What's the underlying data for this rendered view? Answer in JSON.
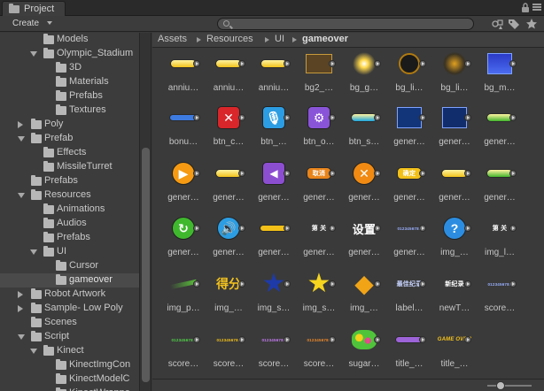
{
  "window": {
    "tab_title": "Project"
  },
  "toolbar": {
    "create_label": "Create",
    "search_placeholder": ""
  },
  "tree": [
    {
      "label": "Models",
      "depth": 1,
      "arrow": "none"
    },
    {
      "label": "Olympic_Stadium",
      "depth": 1,
      "arrow": "open"
    },
    {
      "label": "3D",
      "depth": 2,
      "arrow": "none"
    },
    {
      "label": "Materials",
      "depth": 2,
      "arrow": "none"
    },
    {
      "label": "Prefabs",
      "depth": 2,
      "arrow": "none"
    },
    {
      "label": "Textures",
      "depth": 2,
      "arrow": "none"
    },
    {
      "label": "Poly",
      "depth": 0,
      "arrow": "closed"
    },
    {
      "label": "Prefab",
      "depth": 0,
      "arrow": "open"
    },
    {
      "label": "Effects",
      "depth": 1,
      "arrow": "none"
    },
    {
      "label": "MissileTurret",
      "depth": 1,
      "arrow": "none"
    },
    {
      "label": "Prefabs",
      "depth": 0,
      "arrow": "none"
    },
    {
      "label": "Resources",
      "depth": 0,
      "arrow": "open"
    },
    {
      "label": "Animations",
      "depth": 1,
      "arrow": "none"
    },
    {
      "label": "Audios",
      "depth": 1,
      "arrow": "none"
    },
    {
      "label": "Prefabs",
      "depth": 1,
      "arrow": "none"
    },
    {
      "label": "UI",
      "depth": 1,
      "arrow": "open"
    },
    {
      "label": "Cursor",
      "depth": 2,
      "arrow": "none"
    },
    {
      "label": "gameover",
      "depth": 2,
      "arrow": "none",
      "selected": true
    },
    {
      "label": "Robot Artwork",
      "depth": 0,
      "arrow": "closed"
    },
    {
      "label": "Sample- Low Poly",
      "depth": 0,
      "arrow": "closed"
    },
    {
      "label": "Scenes",
      "depth": 0,
      "arrow": "none"
    },
    {
      "label": "Script",
      "depth": 0,
      "arrow": "open"
    },
    {
      "label": "Kinect",
      "depth": 1,
      "arrow": "open"
    },
    {
      "label": "KinectImgCon",
      "depth": 2,
      "arrow": "none"
    },
    {
      "label": "KinectModelC",
      "depth": 2,
      "arrow": "none"
    },
    {
      "label": "KinectWrappe",
      "depth": 2,
      "arrow": "none"
    }
  ],
  "breadcrumb": [
    "Assets",
    "Resources",
    "UI",
    "gameover"
  ],
  "assets": [
    {
      "label": "anniu…",
      "icon": "yellow-pill-icon",
      "text": "",
      "color": "#f1c21b"
    },
    {
      "label": "anniu…",
      "icon": "yellow-pill-icon",
      "text": "",
      "color": "#f1c21b"
    },
    {
      "label": "anniu…",
      "icon": "yellow-pill-icon",
      "text": "",
      "color": "#f1c21b"
    },
    {
      "label": "bg2_…",
      "icon": "gold-frame-icon",
      "text": "",
      "color": "#8a6a2a"
    },
    {
      "label": "bg_g…",
      "icon": "sunburst-icon",
      "text": "",
      "color": "#ffd84a"
    },
    {
      "label": "bg_li…",
      "icon": "ring-glow-icon",
      "text": "",
      "color": "#b07a10"
    },
    {
      "label": "bg_li…",
      "icon": "orb-glow-icon",
      "text": "",
      "color": "#e0a020"
    },
    {
      "label": "bg_m…",
      "icon": "blue-panel-icon",
      "text": "",
      "color": "#2d40c8"
    },
    {
      "label": "bonu…",
      "icon": "blue-bar-icon",
      "text": "",
      "color": "#3e7be0"
    },
    {
      "label": "btn_c…",
      "icon": "red-close-icon",
      "text": "✕",
      "color": "#d8262a"
    },
    {
      "label": "btn_…",
      "icon": "microphone-icon",
      "text": "🎙",
      "color": "#2c9de2"
    },
    {
      "label": "btn_o…",
      "icon": "gear-button-icon",
      "text": "⚙",
      "color": "#8a54d8"
    },
    {
      "label": "btn_s…",
      "icon": "cyan-pill-icon",
      "text": "",
      "color": "#1fa7de"
    },
    {
      "label": "gener…",
      "icon": "dark-blue-panel-icon",
      "text": "",
      "color": "#12357a"
    },
    {
      "label": "gener…",
      "icon": "dark-blue-panel-icon",
      "text": "",
      "color": "#122d6b"
    },
    {
      "label": "gener…",
      "icon": "green-pill-icon",
      "text": "",
      "color": "#42b52d"
    },
    {
      "label": "gener…",
      "icon": "orange-play-icon",
      "text": "▶",
      "color": "#f59a12"
    },
    {
      "label": "gener…",
      "icon": "yellow-pill-icon",
      "text": "",
      "color": "#f1c21b"
    },
    {
      "label": "gener…",
      "icon": "purple-back-icon",
      "text": "◀",
      "color": "#8c4ed0"
    },
    {
      "label": "gener…",
      "icon": "red-cancel-pill-icon",
      "text": "取消",
      "color": "#e8841a"
    },
    {
      "label": "gener…",
      "icon": "orange-x-icon",
      "text": "✕",
      "color": "#f08a12"
    },
    {
      "label": "gener…",
      "icon": "yellow-confirm-pill-icon",
      "text": "确定",
      "color": "#f2c018"
    },
    {
      "label": "gener…",
      "icon": "yellow-pill-icon",
      "text": "",
      "color": "#f1c21b"
    },
    {
      "label": "gener…",
      "icon": "green-pill-icon",
      "text": "",
      "color": "#42b52d"
    },
    {
      "label": "gener…",
      "icon": "green-refresh-icon",
      "text": "↻",
      "color": "#3fb82e"
    },
    {
      "label": "gener…",
      "icon": "sound-icon",
      "text": "🔊",
      "color": "#2c9de2"
    },
    {
      "label": "gener…",
      "icon": "yellow-bar-icon",
      "text": "",
      "color": "#f2c018"
    },
    {
      "label": "gener…",
      "icon": "level-text-icon",
      "text": "第 关",
      "color": "#ffffff"
    },
    {
      "label": "gener…",
      "icon": "settings-text-icon",
      "text": "设置",
      "color": "#ffffff"
    },
    {
      "label": "gener…",
      "icon": "digits-icon",
      "text": "0123456789",
      "color": "#9ab0ff"
    },
    {
      "label": "img_…",
      "icon": "help-icon",
      "text": "?",
      "color": "#2c8de0"
    },
    {
      "label": "img_l…",
      "icon": "level-text-icon",
      "text": "第 关",
      "color": "#ffffff"
    },
    {
      "label": "img_p…",
      "icon": "progress-streak-icon",
      "text": "",
      "color": "#5ac23a"
    },
    {
      "label": "img_…",
      "icon": "score-text-icon",
      "text": "得分",
      "color": "#f3c21d"
    },
    {
      "label": "img_s…",
      "icon": "blue-star-icon",
      "text": "★",
      "color": "#1e3aa8"
    },
    {
      "label": "img_s…",
      "icon": "gold-star-icon",
      "text": "★",
      "color": "#f6d51f"
    },
    {
      "label": "img_…",
      "icon": "diamond-icon",
      "text": "◆",
      "color": "#f0a416"
    },
    {
      "label": "label…",
      "icon": "label-text-icon",
      "text": "最佳纪录",
      "color": "#c8d4ff"
    },
    {
      "label": "newT…",
      "icon": "new-record-text-icon",
      "text": "新纪录",
      "color": "#ffffff"
    },
    {
      "label": "score…",
      "icon": "digits-icon",
      "text": "0123456789",
      "color": "#9ab0ff"
    },
    {
      "label": "score…",
      "icon": "digits-icon",
      "text": "0123456789",
      "color": "#52d24a"
    },
    {
      "label": "score…",
      "icon": "digits-icon",
      "text": "0123456789",
      "color": "#f5c21b"
    },
    {
      "label": "score…",
      "icon": "digits-icon",
      "text": "0123456789",
      "color": "#c47cf0"
    },
    {
      "label": "score…",
      "icon": "digits-icon",
      "text": "0123456789",
      "color": "#f08a2a"
    },
    {
      "label": "sugar…",
      "icon": "candy-pile-icon",
      "text": "",
      "color": "#4fc43a"
    },
    {
      "label": "title_…",
      "icon": "purple-bar-icon",
      "text": "",
      "color": "#9d63d8"
    },
    {
      "label": "title_…",
      "icon": "game-over-text-icon",
      "text": "GAME OVER",
      "color": "#f5c21b"
    }
  ]
}
